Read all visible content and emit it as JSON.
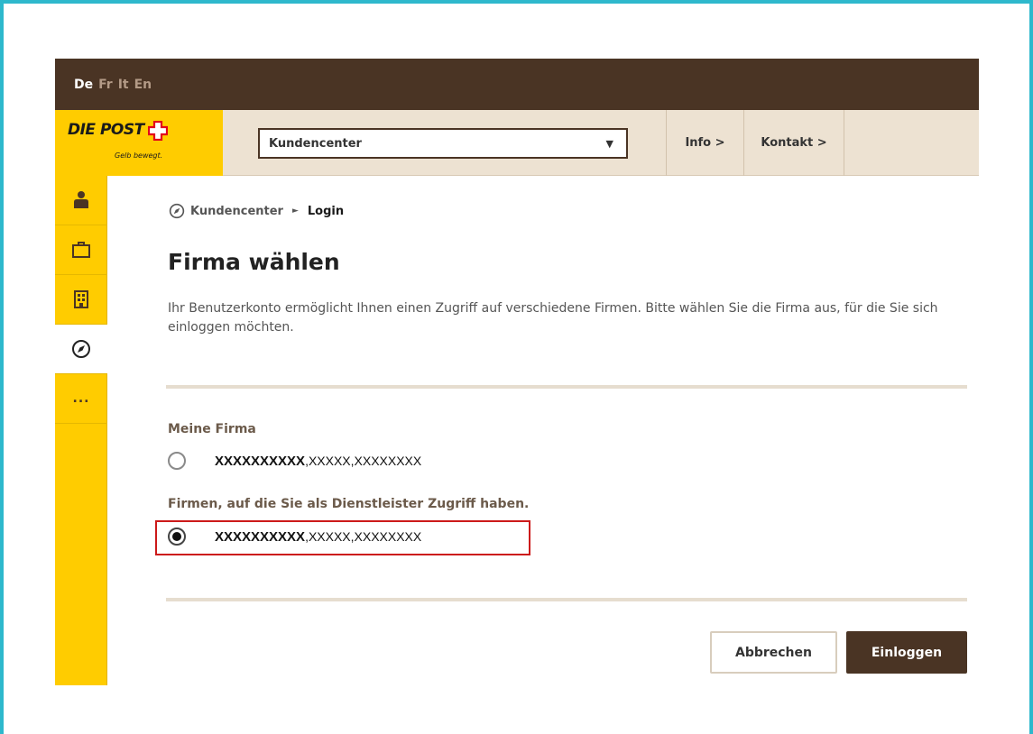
{
  "languages": [
    {
      "code": "De",
      "active": true
    },
    {
      "code": "Fr",
      "active": false
    },
    {
      "code": "It",
      "active": false
    },
    {
      "code": "En",
      "active": false
    }
  ],
  "logo": {
    "text": "DIE POST",
    "tagline": "Gelb bewegt.",
    "brand_color": "#ffcc00"
  },
  "header": {
    "select_value": "Kundencenter",
    "nav_info": "Info >",
    "nav_kontakt": "Kontakt >"
  },
  "rail": {
    "icons": [
      "person-icon",
      "briefcase-icon",
      "building-icon",
      "compass-icon",
      "more-icon"
    ],
    "more_label": "...",
    "active": "compass-icon"
  },
  "breadcrumb": {
    "root": "Kundencenter",
    "current": "Login"
  },
  "page": {
    "title": "Firma wählen",
    "intro": "Ihr Benutzerkonto ermöglicht Ihnen einen Zugriff auf verschiedene Firmen. Bitte wählen Sie die Firma aus, für die Sie sich einloggen möchten."
  },
  "groups": {
    "own_label": "Meine Firma",
    "own_option": {
      "name": "XXXXXXXXXX",
      "rest": ",XXXXX,XXXXXXXX",
      "checked": false
    },
    "service_label": "Firmen, auf die Sie als Dienstleister Zugriff haben.",
    "service_option": {
      "name": "XXXXXXXXXX",
      "rest": ",XXXXX,XXXXXXXX",
      "checked": true
    }
  },
  "buttons": {
    "cancel": "Abbrechen",
    "login": "Einloggen"
  },
  "colors": {
    "accent_brown": "#4a3424",
    "highlight_red": "#cc1a1a",
    "frame": "#2eb8cc"
  }
}
